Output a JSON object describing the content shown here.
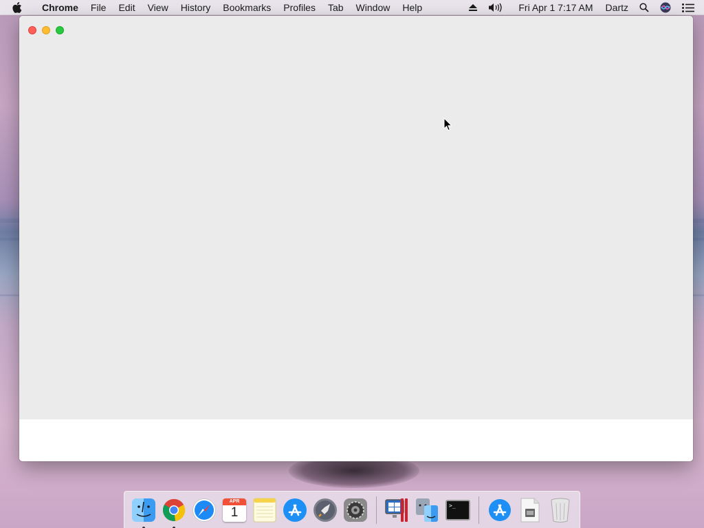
{
  "menubar": {
    "app_name": "Chrome",
    "items": [
      "File",
      "Edit",
      "View",
      "History",
      "Bookmarks",
      "Profiles",
      "Tab",
      "Window",
      "Help"
    ],
    "datetime": "Fri Apr 1  7:17 AM",
    "user": "Dartz"
  },
  "window": {
    "traffic_lights": {
      "close": "#fe5f57",
      "minimize": "#febc2e",
      "zoom": "#28c840"
    }
  },
  "dock": {
    "items": [
      {
        "name": "Finder",
        "icon": "finder-icon",
        "running": true
      },
      {
        "name": "Google Chrome",
        "icon": "chrome-icon",
        "running": true
      },
      {
        "name": "Safari",
        "icon": "safari-icon",
        "running": false
      },
      {
        "name": "Calendar",
        "icon": "calendar-icon",
        "running": false,
        "month": "APR",
        "day": "1"
      },
      {
        "name": "Notes",
        "icon": "notes-icon",
        "running": false
      },
      {
        "name": "App Store",
        "icon": "app-store-icon",
        "running": false
      },
      {
        "name": "Launchpad",
        "icon": "launchpad-icon",
        "running": false
      },
      {
        "name": "System Preferences",
        "icon": "system-preferences-icon",
        "running": false
      },
      {
        "name": "Parallels",
        "icon": "parallels-icon",
        "running": false
      },
      {
        "name": "Migration Assistant",
        "icon": "migration-assistant-icon",
        "running": false
      },
      {
        "name": "Terminal",
        "icon": "terminal-icon",
        "running": false,
        "prompt": ">_"
      },
      {
        "name": "App Store Downloads",
        "icon": "downloads-icon",
        "running": false
      },
      {
        "name": "Document",
        "icon": "document-icon",
        "running": false
      },
      {
        "name": "Trash",
        "icon": "trash-icon",
        "running": false
      }
    ]
  }
}
